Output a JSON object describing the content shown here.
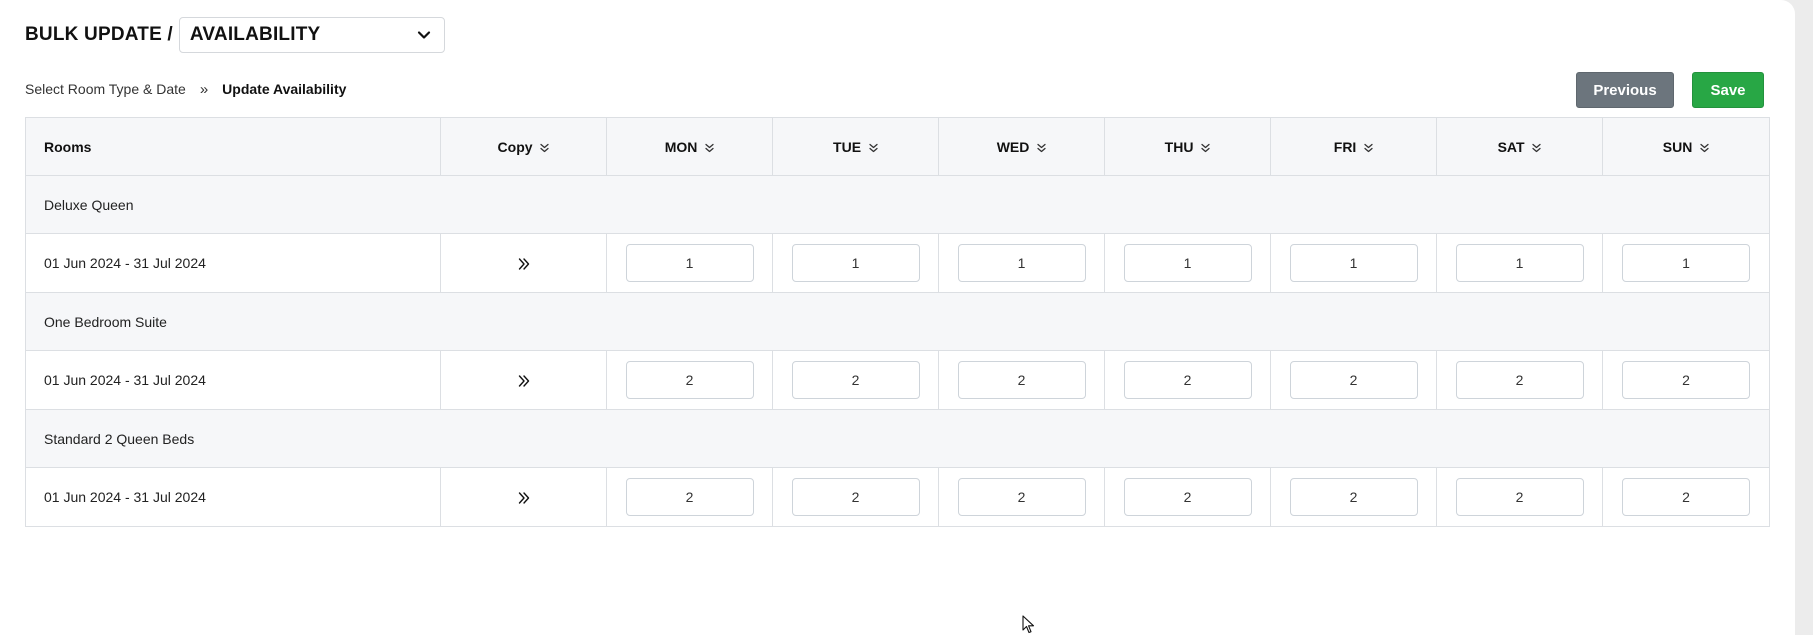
{
  "header": {
    "title": "BULK UPDATE /",
    "mode_select_value": "AVAILABILITY"
  },
  "breadcrumb": {
    "step1": "Select Room Type & Date",
    "separator": "»",
    "step2": "Update Availability"
  },
  "actions": {
    "previous_label": "Previous",
    "save_label": "Save"
  },
  "table": {
    "columns": {
      "rooms": "Rooms",
      "copy": "Copy",
      "days": [
        "MON",
        "TUE",
        "WED",
        "THU",
        "FRI",
        "SAT",
        "SUN"
      ]
    },
    "groups": [
      {
        "room": "Deluxe Queen",
        "date_range": "01 Jun 2024 - 31 Jul 2024",
        "values": [
          "1",
          "1",
          "1",
          "1",
          "1",
          "1",
          "1"
        ]
      },
      {
        "room": "One Bedroom Suite",
        "date_range": "01 Jun 2024 - 31 Jul 2024",
        "values": [
          "2",
          "2",
          "2",
          "2",
          "2",
          "2",
          "2"
        ]
      },
      {
        "room": "Standard 2 Queen Beds",
        "date_range": "01 Jun 2024 - 31 Jul 2024",
        "values": [
          "2",
          "2",
          "2",
          "2",
          "2",
          "2",
          "2"
        ]
      }
    ]
  },
  "icons": {
    "select_chevron": "chevron-down-icon",
    "sort": "double-chevron-down-icon",
    "copy": "double-chevron-right-icon",
    "cursor": "mouse-pointer-icon"
  },
  "colors": {
    "previous_button": "#6c757d",
    "save_button": "#28a745",
    "header_bg": "#f6f7f9",
    "border": "#dcdfe3"
  }
}
